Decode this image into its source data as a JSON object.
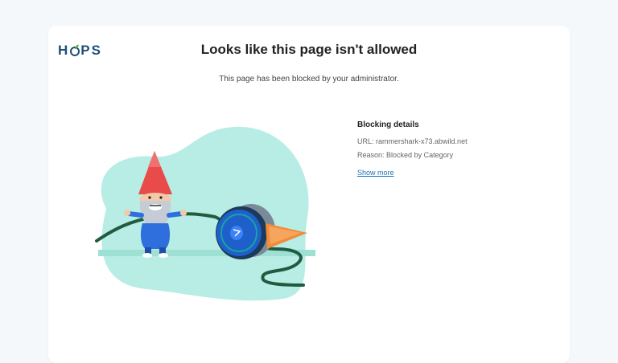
{
  "logo": {
    "text_before": "H",
    "text_after": "PS",
    "brand_color": "#1f4e79",
    "leaf_color": "#5aaa3c"
  },
  "page": {
    "title": "Looks like this page isn't allowed",
    "subtitle": "This page has been blocked by your administrator."
  },
  "details": {
    "heading": "Blocking details",
    "url_label": "URL:",
    "url_value": "rammershark-x73.abwild.net",
    "reason_label": "Reason:",
    "reason_value": "Blocked by Category",
    "show_more": "Show more"
  },
  "colors": {
    "blob": "#b7ede4",
    "gnome_hat": "#e94b4b",
    "gnome_body": "#2f6fdd",
    "cable": "#1f5c3f",
    "spool": "#1f5fc9",
    "cone": "#f28c3a",
    "link": "#1a73b8"
  }
}
